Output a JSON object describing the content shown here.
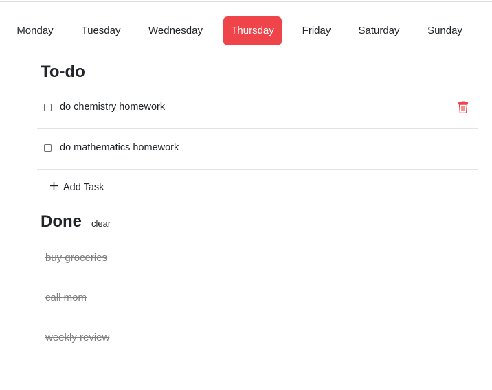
{
  "colors": {
    "accent": "#f0444b",
    "text": "#212529",
    "done_text": "#808080",
    "divider": "#e3e3e3"
  },
  "days": [
    {
      "label": "Monday",
      "active": false
    },
    {
      "label": "Tuesday",
      "active": false
    },
    {
      "label": "Wednesday",
      "active": false
    },
    {
      "label": "Thursday",
      "active": true
    },
    {
      "label": "Friday",
      "active": false
    },
    {
      "label": "Saturday",
      "active": false
    },
    {
      "label": "Sunday",
      "active": false
    }
  ],
  "todo": {
    "title": "To-do",
    "tasks": [
      {
        "text": "do chemistry homework",
        "checked": false,
        "show_delete": true,
        "delete_icon": "trash-icon"
      },
      {
        "text": "do mathematics homework",
        "checked": false,
        "show_delete": false
      }
    ],
    "add_label": "Add Task",
    "add_icon": "plus-icon"
  },
  "done": {
    "title": "Done",
    "clear_label": "clear",
    "items": [
      "buy groceries",
      "call mom",
      "weekly review"
    ]
  }
}
